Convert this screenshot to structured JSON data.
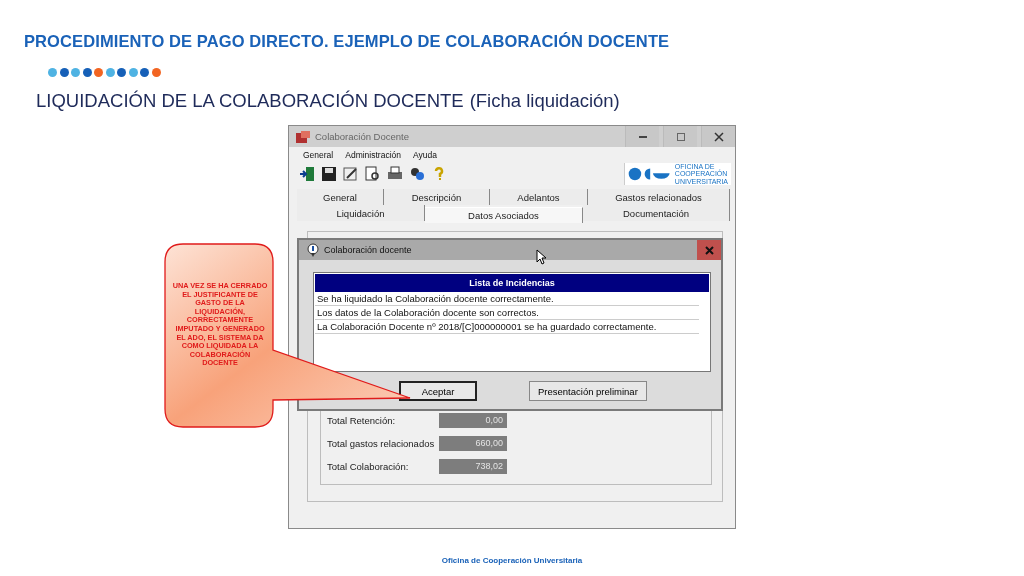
{
  "slide": {
    "title": "PROCEDIMIENTO DE PAGO DIRECTO. EJEMPLO DE COLABORACIÓN DOCENTE",
    "dots": [
      {
        "color": "#4fb3e3"
      },
      {
        "color": "#1660b8"
      },
      {
        "color": "#4fb3e3"
      },
      {
        "color": "#1660b8"
      },
      {
        "color": "#f26522"
      },
      {
        "color": "#4fb3e3"
      },
      {
        "color": "#1660b8"
      },
      {
        "color": "#4fb3e3"
      },
      {
        "color": "#1660b8"
      },
      {
        "color": "#f26522"
      }
    ],
    "subtitle": "LIQUIDACIÓN DE LA COLABORACIÓN DOCENTE",
    "subtitle_note": "(Ficha liquidación)",
    "footer": "Oficina de Cooperación Universitaria"
  },
  "window": {
    "title": "Colaboración Docente",
    "menu": [
      "General",
      "Administración",
      "Ayuda"
    ],
    "logo_lines": [
      "OFICINA DE",
      "COOPERACIÓN",
      "UNIVERSITARIA"
    ],
    "tab_rows": [
      [
        {
          "label": "General",
          "selected": false
        },
        {
          "label": "Descripción",
          "selected": false
        },
        {
          "label": "Adelantos",
          "selected": false
        },
        {
          "label": "Gastos relacionados",
          "selected": false
        }
      ],
      [
        {
          "label": "Liquidación",
          "selected": false
        },
        {
          "label": "Datos Asociados",
          "selected": true
        },
        {
          "label": "Documentación",
          "selected": false
        }
      ]
    ],
    "totals": [
      {
        "label": "Total Retención:",
        "value": "0,00"
      },
      {
        "label": "Total gastos relacionados",
        "value": "660,00"
      },
      {
        "label": "Total Colaboración:",
        "value": "738,02"
      }
    ]
  },
  "dialog": {
    "title": "Colaboración docente",
    "list_header": "Lista de Incidencias",
    "rows": [
      "Se ha liquidado la Colaboración docente correctamente.",
      "Los datos de la Colaboración docente son correctos.",
      "La Colaboración Docente nº 2018/[C]000000001 se ha guardado correctamente."
    ],
    "buttons": [
      {
        "label": "Aceptar",
        "default": true
      },
      {
        "label": "Presentación preliminar",
        "default": false
      }
    ]
  },
  "callout": {
    "text": "UNA VEZ SE HA CERRADO EL JUSTIFICANTE DE GASTO DE LA LIQUIDACIÓN, CORRECTAMENTE IMPUTADO Y GENERADO EL ADO, EL SISTEMA DA COMO LIQUIDADA LA COLABORACIÓN DOCENTE"
  }
}
